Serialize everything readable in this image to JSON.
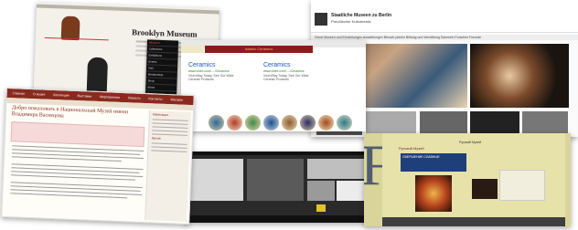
{
  "brooklyn": {
    "title": "Brooklyn Museum"
  },
  "berlin": {
    "title": "Staatliche Museen zu Berlin",
    "subtitle": "Preußischer Kulturbesitz",
    "nav": "Home  Museen und Einrichtungen  Ausstellungen  Besuch planen  Bildung und Vermittlung  Sammeln  Forschen  Freunde"
  },
  "ceramics": {
    "banner": "Islamic Ceramics",
    "ads": [
      {
        "heading": "Ceramics",
        "url": "www.vivint.com/..../Ceramics",
        "desc": "Visit eBay Today, See Our Wide Ceramic Products"
      },
      {
        "heading": "Ceramics",
        "url": "www.vivint.com/..../Ceramics",
        "desc": "Visit eBay Today, See Our Wide Ceramic Products"
      }
    ]
  },
  "vasnetsov": {
    "nav": [
      "Главная",
      "О музее",
      "Коллекция",
      "Выставки",
      "Мероприятия",
      "Новости",
      "Контакты",
      "Магазин"
    ],
    "heading": "Добро пожаловать в Национальный Музей имени Владимира Васнецова",
    "sidebar_title": "Навигация",
    "sidebar_title2": "Архив"
  },
  "russian": {
    "banner1": "Русский Музей",
    "banner2": "Русский Музей",
    "event": "СВЕРШЕНИЕ СЛАВНЫЕ"
  },
  "brooklyn_menu": [
    "Museum",
    "Collections",
    "Exhibitions",
    "Events",
    "Visit",
    "Membership",
    "Shop",
    "About",
    "Contact",
    "Sign In",
    "Search"
  ]
}
